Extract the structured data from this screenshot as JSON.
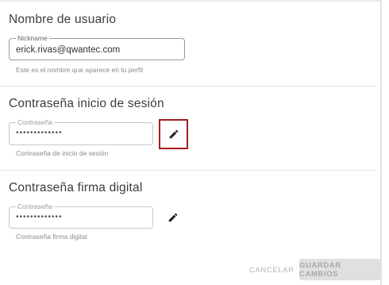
{
  "username_section": {
    "title": "Nombre de usuario",
    "field_label": "Nickname",
    "field_value": "erick.rivas@qwantec.com",
    "helper": "Este es el nombre que aparece en tu perfil"
  },
  "login_password_section": {
    "title": "Contraseña inicio de sesión",
    "field_label": "Contraseña",
    "field_value": "•••••••••••••",
    "helper": "Contraseña de inicio de sesión",
    "edit_icon": "pencil-icon"
  },
  "signature_password_section": {
    "title": "Contraseña firma digital",
    "field_label": "Contraseña",
    "field_value": "•••••••••••••",
    "helper": "Contraseña firma digital",
    "edit_icon": "pencil-icon"
  },
  "actions": {
    "cancel_label": "CANCELAR",
    "save_label": "GUARDAR CAMBIOS"
  },
  "colors": {
    "highlight_border": "#a61d1d",
    "disabled_text": "#b5b5b5",
    "disabled_button_bg": "#e0e0e0"
  }
}
